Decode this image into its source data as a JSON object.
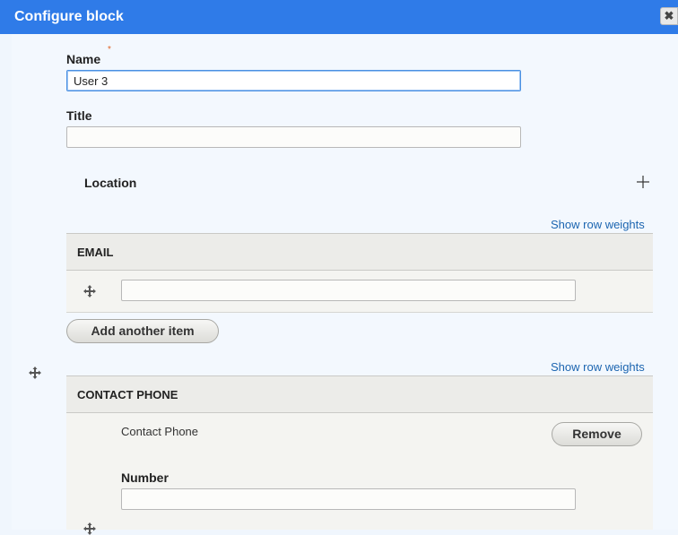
{
  "dialog": {
    "title": "Configure block",
    "close_symbol": "✖"
  },
  "form": {
    "name": {
      "label": "Name",
      "required_marker": "*",
      "value": "User 3"
    },
    "title": {
      "label": "Title",
      "value": ""
    },
    "location": {
      "label": "Location"
    },
    "email_section": {
      "show_weights": "Show row weights",
      "header": "EMAIL",
      "rows": [
        {
          "value": ""
        }
      ],
      "add_button": "Add another item"
    },
    "contact_phone_section": {
      "show_weights": "Show row weights",
      "header": "CONTACT PHONE",
      "item_label": "Contact Phone",
      "remove_button": "Remove",
      "number": {
        "label": "Number",
        "value": ""
      }
    }
  },
  "colors": {
    "titlebar": "#2f7be8",
    "background": "#f0f6fd",
    "link": "#1c65b0",
    "required": "#e0672a"
  },
  "icons": [
    "close-icon",
    "plus-icon",
    "drag-handle-icon"
  ]
}
